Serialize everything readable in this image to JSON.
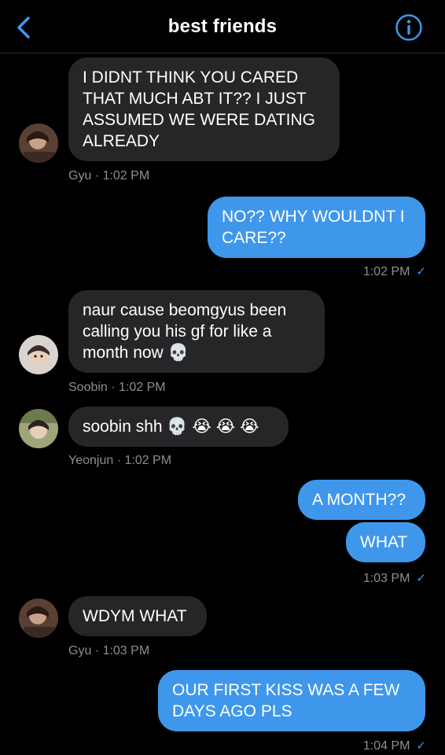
{
  "header": {
    "title": "best friends",
    "back_icon": "chevron-left-icon",
    "info_icon": "info-circle-icon",
    "accent": "#3f97ec"
  },
  "messages": [
    {
      "sender": "Gyu",
      "text": "I DIDNT THINK YOU CARED THAT MUCH ABT IT?? I JUST ASSUMED WE WERE DATING ALREADY",
      "meta": "Gyu · 1:02 PM"
    },
    {
      "sender": "me",
      "text": "NO?? WHY WOULDNT I CARE??",
      "meta": "1:02 PM"
    },
    {
      "sender": "Soobin",
      "text": "naur cause beomgyus been calling you his gf for like a month now 💀",
      "meta": "Soobin · 1:02 PM"
    },
    {
      "sender": "Yeonjun",
      "text": "soobin shh 💀 😭 😭 😭",
      "meta": "Yeonjun · 1:02 PM"
    },
    {
      "sender": "me",
      "text": "A MONTH??"
    },
    {
      "sender": "me",
      "text": "WHAT",
      "meta": "1:03 PM"
    },
    {
      "sender": "Gyu",
      "text": "WDYM WHAT",
      "meta": "Gyu · 1:03 PM"
    },
    {
      "sender": "me",
      "text": "OUR FIRST KISS WAS A FEW DAYS AGO PLS",
      "meta": "1:04 PM"
    }
  ],
  "read_mark": "✓"
}
